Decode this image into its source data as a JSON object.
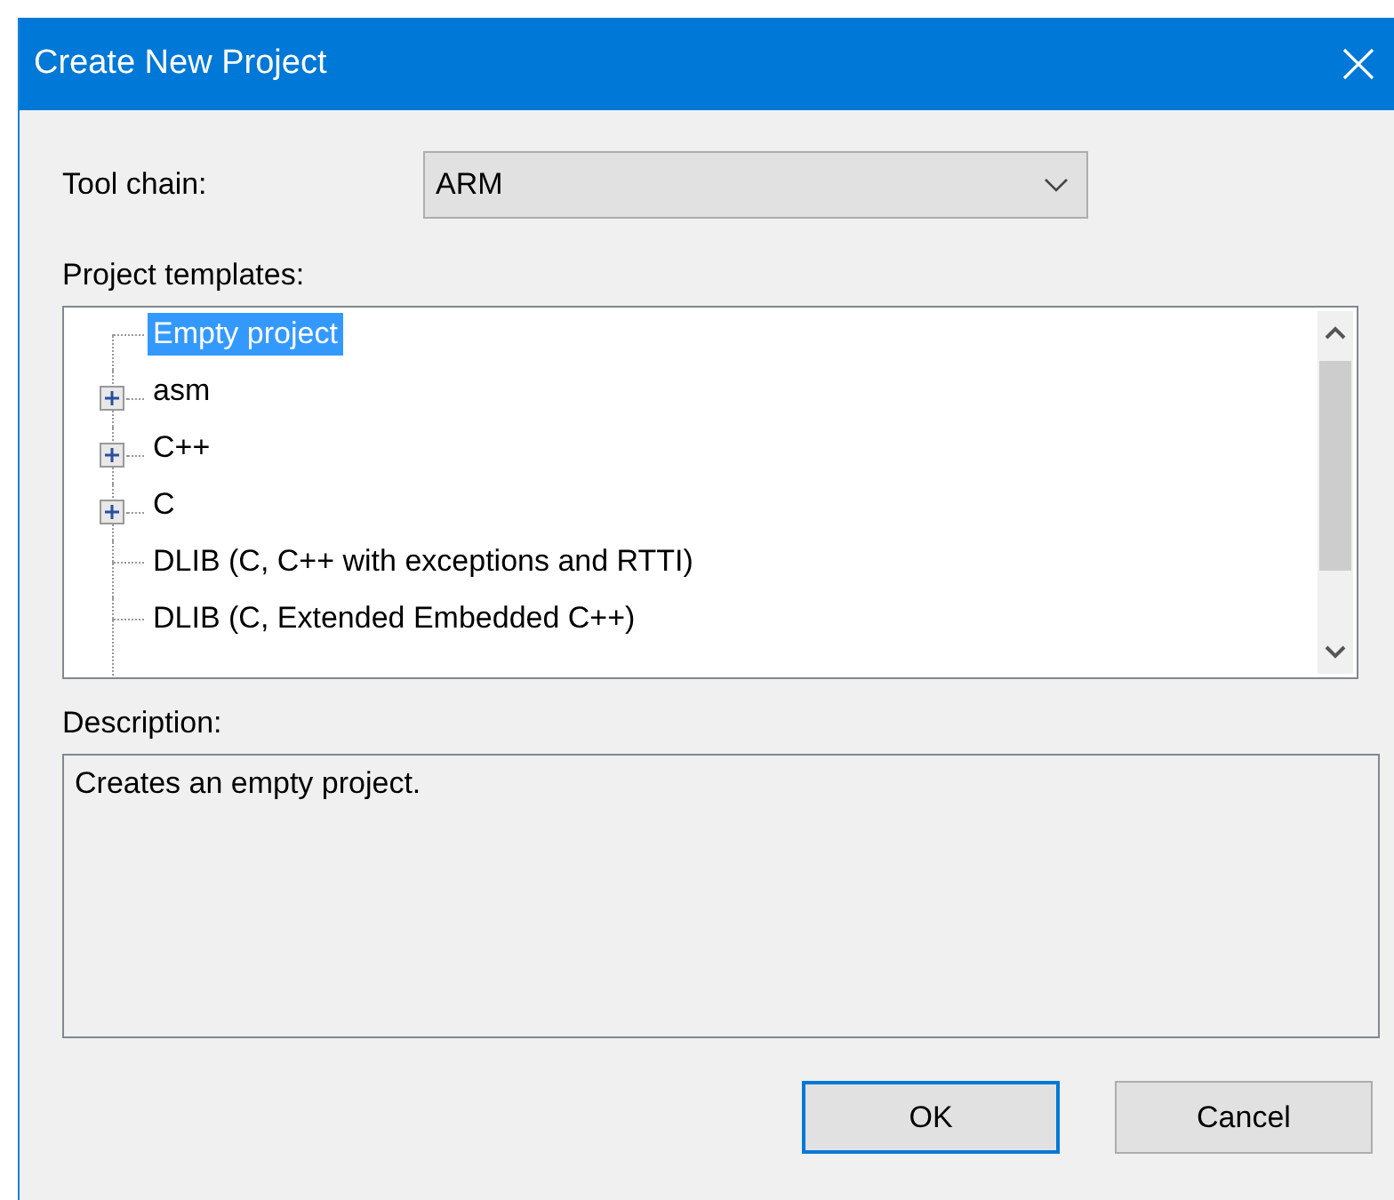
{
  "window": {
    "title": "Create New Project"
  },
  "tool_chain": {
    "label": "Tool chain:",
    "value": "ARM"
  },
  "templates": {
    "label": "Project templates:",
    "items": [
      {
        "label": "Empty project",
        "kind": "leaf",
        "selected": true
      },
      {
        "label": "asm",
        "kind": "folder",
        "expanded": false,
        "selected": false
      },
      {
        "label": "C++",
        "kind": "folder",
        "expanded": false,
        "selected": false
      },
      {
        "label": "C",
        "kind": "folder",
        "expanded": false,
        "selected": false
      },
      {
        "label": "DLIB (C, C++ with exceptions and RTTI)",
        "kind": "leaf",
        "selected": false
      },
      {
        "label": "DLIB (C, Extended Embedded C++)",
        "kind": "leaf",
        "selected": false
      }
    ]
  },
  "description": {
    "label": "Description:",
    "text": "Creates an empty project."
  },
  "buttons": [
    {
      "label": "OK",
      "default": true
    },
    {
      "label": "Cancel",
      "default": false
    }
  ]
}
